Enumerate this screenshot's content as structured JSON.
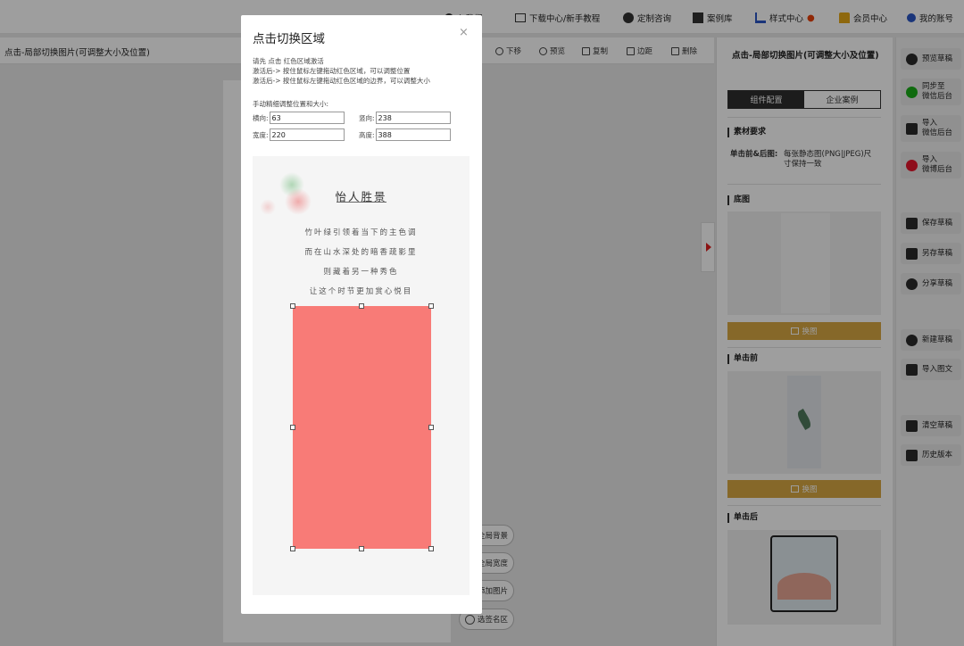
{
  "topnav": {
    "items": [
      "入我们",
      "下载中心/新手教程",
      "定制咨询",
      "案例库",
      "样式中心",
      "会员中心",
      "我的账号"
    ]
  },
  "toolbar": {
    "doc_title": "点击-局部切换图片(可调整大小及位置)",
    "buttons": [
      "下移",
      "预览",
      "复制",
      "边距",
      "删除"
    ]
  },
  "side_pills": [
    "全局背景",
    "全局宽度",
    "添加图片",
    "选签名区"
  ],
  "right_panel": {
    "title": "点击-局部切换图片(可调整大小及位置)",
    "tabs": [
      "组件配置",
      "企业案例"
    ],
    "section_requirements": "素材要求",
    "requirement_label": "单击前&后图:",
    "requirement_text_1": "每张静态图(PNG|JPEG)尺",
    "requirement_text_2": "寸保持一致",
    "section_base": "底图",
    "change_button": "换图",
    "section_before": "单击前",
    "section_after": "单击后"
  },
  "side_strip": {
    "buttons": [
      {
        "label1": "预览草稿",
        "label2": "",
        "icon": "eye-icon"
      },
      {
        "label1": "同步至",
        "label2": "微信后台",
        "icon": "sync-icon"
      },
      {
        "label1": "导入",
        "label2": "微信后台",
        "icon": "code-icon"
      },
      {
        "label1": "导入",
        "label2": "微博后台",
        "icon": "weibo-icon"
      },
      {
        "label1": "保存草稿",
        "label2": "",
        "icon": "save-icon"
      },
      {
        "label1": "另存草稿",
        "label2": "",
        "icon": "save-as-icon"
      },
      {
        "label1": "分享草稿",
        "label2": "",
        "icon": "share-icon"
      },
      {
        "label1": "新建草稿",
        "label2": "",
        "icon": "plus-icon"
      },
      {
        "label1": "导入图文",
        "label2": "",
        "icon": "import-icon"
      },
      {
        "label1": "清空草稿",
        "label2": "",
        "icon": "eraser-icon"
      },
      {
        "label1": "历史版本",
        "label2": "",
        "icon": "history-icon"
      }
    ]
  },
  "modal": {
    "title": "点击切换区域",
    "close": "×",
    "hint1": "请先 点击 红色区域激活",
    "hint2": "激活后-> 按住鼠标左键拖动红色区域，可以调整位置",
    "hint3": "激活后-> 按住鼠标左键拖动红色区域的边界，可以调整大小",
    "manual_label": "手动精细调整位置和大小:",
    "fields": {
      "x_label": "横向:",
      "x_value": "63",
      "y_label": "竖向:",
      "y_value": "238",
      "w_label": "宽度:",
      "w_value": "220",
      "h_label": "高度:",
      "h_value": "388"
    },
    "preview": {
      "title": "怡人胜景",
      "lines": [
        "竹叶绿引领着当下的主色调",
        "而在山水深处的暗香疏影里",
        "则藏着另一种秀色",
        "让这个时节更加赏心悦目"
      ]
    }
  },
  "colors": {
    "accent_yellow": "#d9a843",
    "selection_red": "#f87b77",
    "tab_active": "#2e2e2e"
  }
}
